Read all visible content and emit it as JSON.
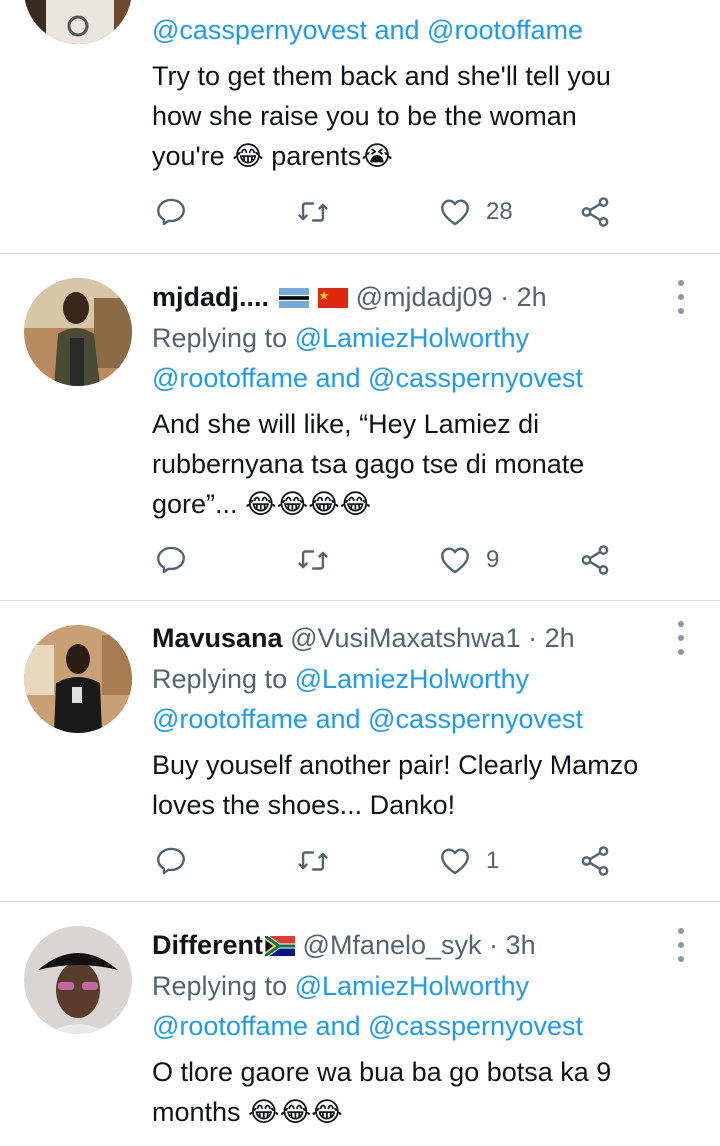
{
  "tweets": [
    {
      "name": "",
      "handle": "",
      "time": "",
      "replying_label": "",
      "reply_targets_line1": "",
      "reply_targets_line2": "@casspernyovest and @rootoffame",
      "text_lines": [
        "Try to get them back and she'll tell you",
        "how she raise you to be the woman",
        "you're 😂 parents😭"
      ],
      "counts": {
        "reply": "",
        "retweet": "",
        "like": "28"
      }
    },
    {
      "name": "mjdadj....",
      "flags": [
        "botswana-flag",
        "china-flag"
      ],
      "handle": "@mjdadj09",
      "dot": "·",
      "time": "2h",
      "replying_label": "Replying to",
      "reply_targets_line1": "@LamiezHolworthy",
      "reply_targets_line2": "@rootoffame and @casspernyovest",
      "text_lines": [
        "And she will like, “Hey Lamiez di",
        "rubbernyana tsa gago tse di monate",
        "gore”... 😂😂😂😂"
      ],
      "counts": {
        "reply": "",
        "retweet": "",
        "like": "9"
      }
    },
    {
      "name": "Mavusana",
      "flags": [],
      "handle": "@VusiMaxatshwa1",
      "dot": "·",
      "time": "2h",
      "replying_label": "Replying to",
      "reply_targets_line1": "@LamiezHolworthy",
      "reply_targets_line2": "@rootoffame and @casspernyovest",
      "text_lines": [
        "Buy youself another pair! Clearly Mamzo",
        "loves the shoes... Danko!"
      ],
      "counts": {
        "reply": "",
        "retweet": "",
        "like": "1"
      }
    },
    {
      "name": "Different",
      "flags": [
        "south-africa-flag"
      ],
      "handle": "@Mfanelo_syk",
      "dot": "·",
      "time": "3h",
      "replying_label": "Replying to",
      "reply_targets_line1": "@LamiezHolworthy",
      "reply_targets_line2": "@rootoffame and @casspernyovest",
      "text_lines": [
        "O tlore gaore wa bua ba go botsa ka 9",
        "months 😂😂😂"
      ]
    }
  ],
  "icons": {
    "reply": "reply-icon",
    "retweet": "retweet-icon",
    "like": "like-icon",
    "share": "share-icon",
    "more": "more-options-icon"
  },
  "colors": {
    "link": "#1d9bf0",
    "secondary_text": "#536471",
    "icon": "#536471",
    "divider": "#e1e5e8"
  }
}
